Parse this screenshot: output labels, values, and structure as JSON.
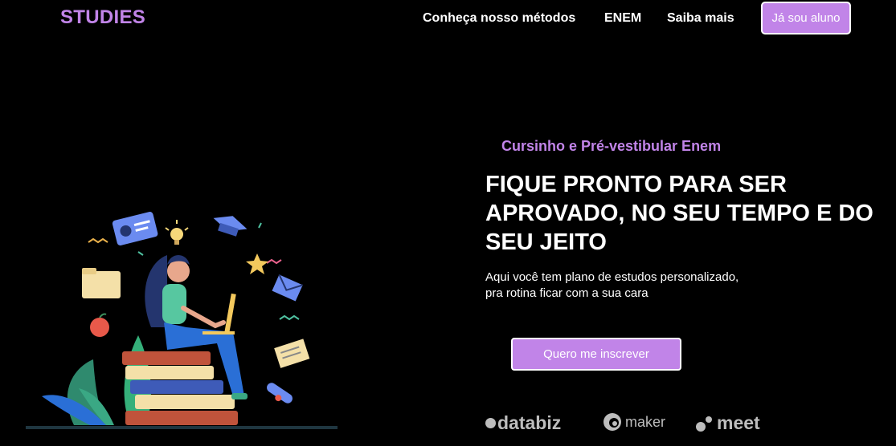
{
  "brand": {
    "logo": "STUDIES"
  },
  "nav": {
    "links": [
      "Conheça nosso métodos",
      "ENEM",
      "Saiba mais"
    ],
    "login_button": "Já sou aluno"
  },
  "hero": {
    "eyebrow": "Cursinho e Pré-vestibular Enem",
    "headline": "FIQUE PRONTO PARA SER APROVADO, NO SEU TEMPO E DO SEU JEITO",
    "subtext_line1": "Aqui você tem plano de estudos personalizado,",
    "subtext_line2": "pra rotina ficar com a sua cara",
    "cta": "Quero me inscrever"
  },
  "partners": {
    "p1": "databiz",
    "p1_mark": "●",
    "p2": "maker",
    "p3": "meet",
    "p3_mark": "·"
  },
  "colors": {
    "accent": "#c184e8",
    "background": "#000000",
    "text": "#ffffff"
  },
  "illustration": {
    "name": "student-studying-laptop-on-books"
  }
}
